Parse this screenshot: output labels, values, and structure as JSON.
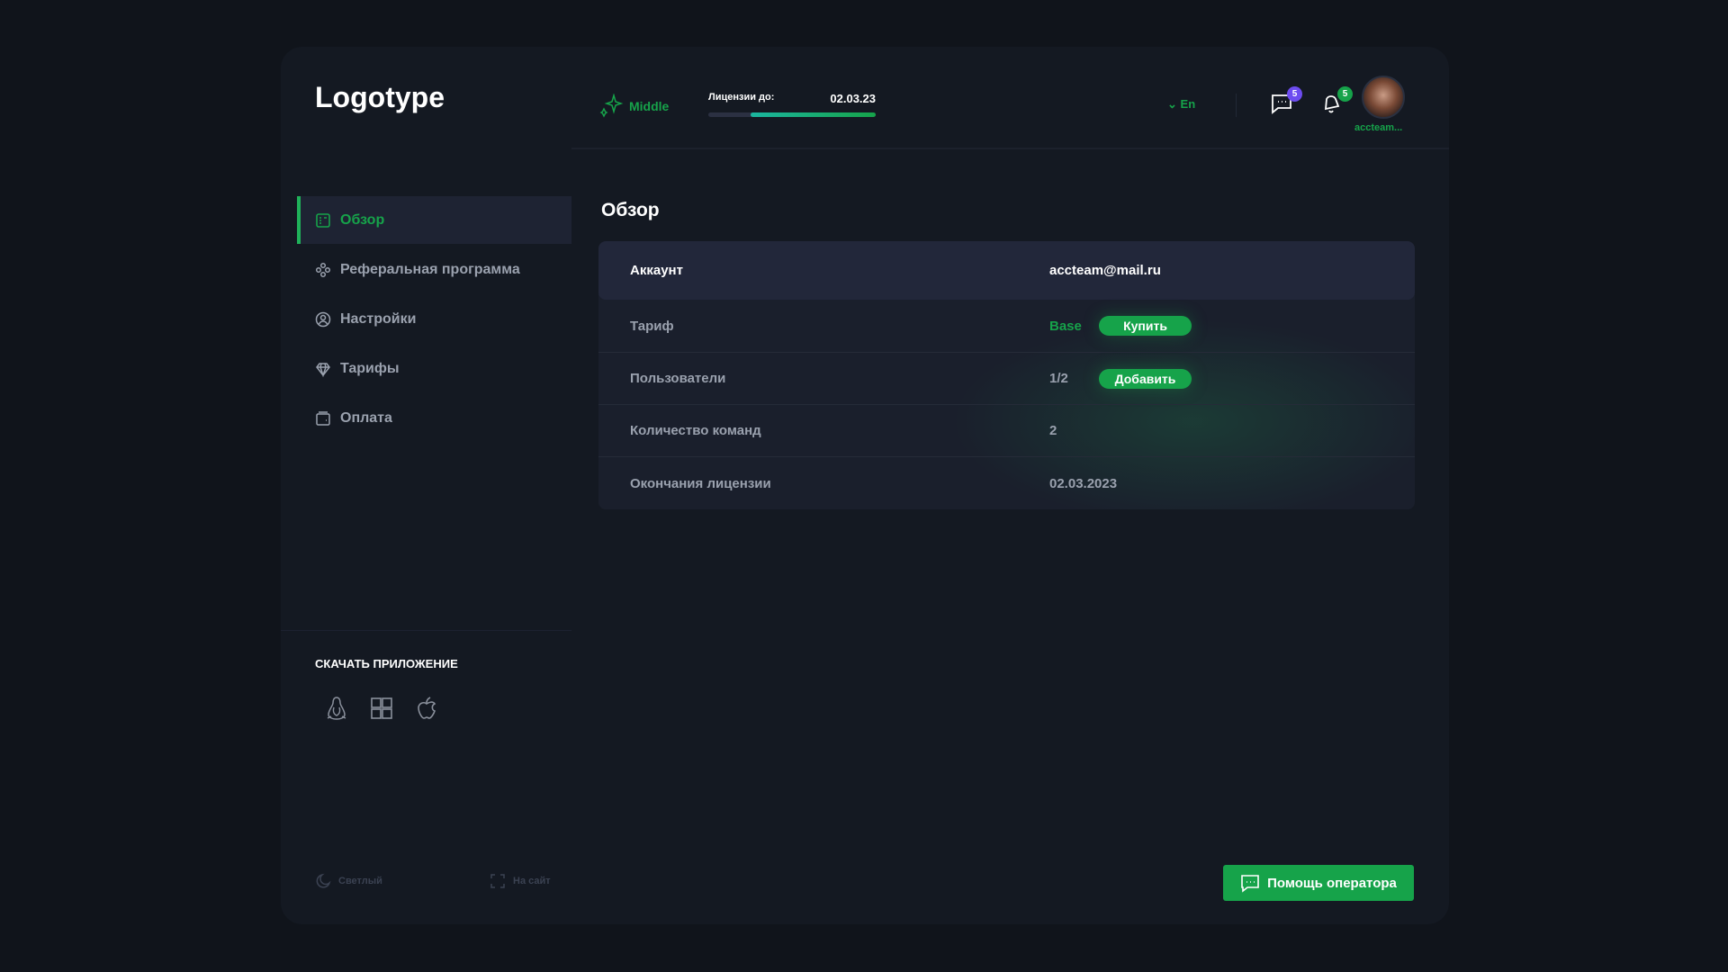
{
  "brand": {
    "logo": "Logotype"
  },
  "sidebar": {
    "items": [
      {
        "label": "Обзор",
        "icon": "overview-icon",
        "active": true
      },
      {
        "label": "Реферальная программа",
        "icon": "referral-icon"
      },
      {
        "label": "Настройки",
        "icon": "user-circle-icon"
      },
      {
        "label": "Тарифы",
        "icon": "diamond-icon"
      },
      {
        "label": "Оплата",
        "icon": "wallet-icon"
      }
    ],
    "download_title": "СКАЧАТЬ ПРИЛОЖЕНИЕ",
    "os": [
      "linux-icon",
      "windows-icon",
      "apple-icon"
    ],
    "theme_label": "Светлый",
    "site_label": "На сайт"
  },
  "header": {
    "plan": "Middle",
    "license_label": "Лицензии до:",
    "license_date": "02.03.23",
    "license_progress": 0.75,
    "lang": "En",
    "messages_count": "5",
    "notifications_count": "5",
    "username": "accteam..."
  },
  "main": {
    "title": "Обзор",
    "account": {
      "label": "Аккаунт",
      "value": "accteam@mail.ru"
    },
    "rows": [
      {
        "label": "Тариф",
        "value": "Base",
        "button": "Купить"
      },
      {
        "label": "Пользователи",
        "value": "1/2",
        "button": "Добавить"
      },
      {
        "label": "Количество команд",
        "value": "2"
      },
      {
        "label": "Окончания лицензии",
        "value": "02.03.2023"
      }
    ],
    "help_button": "Помощь оператора"
  },
  "colors": {
    "accent": "#16a34a",
    "badge_purple": "#6d4cf0",
    "bg": "#141922"
  }
}
